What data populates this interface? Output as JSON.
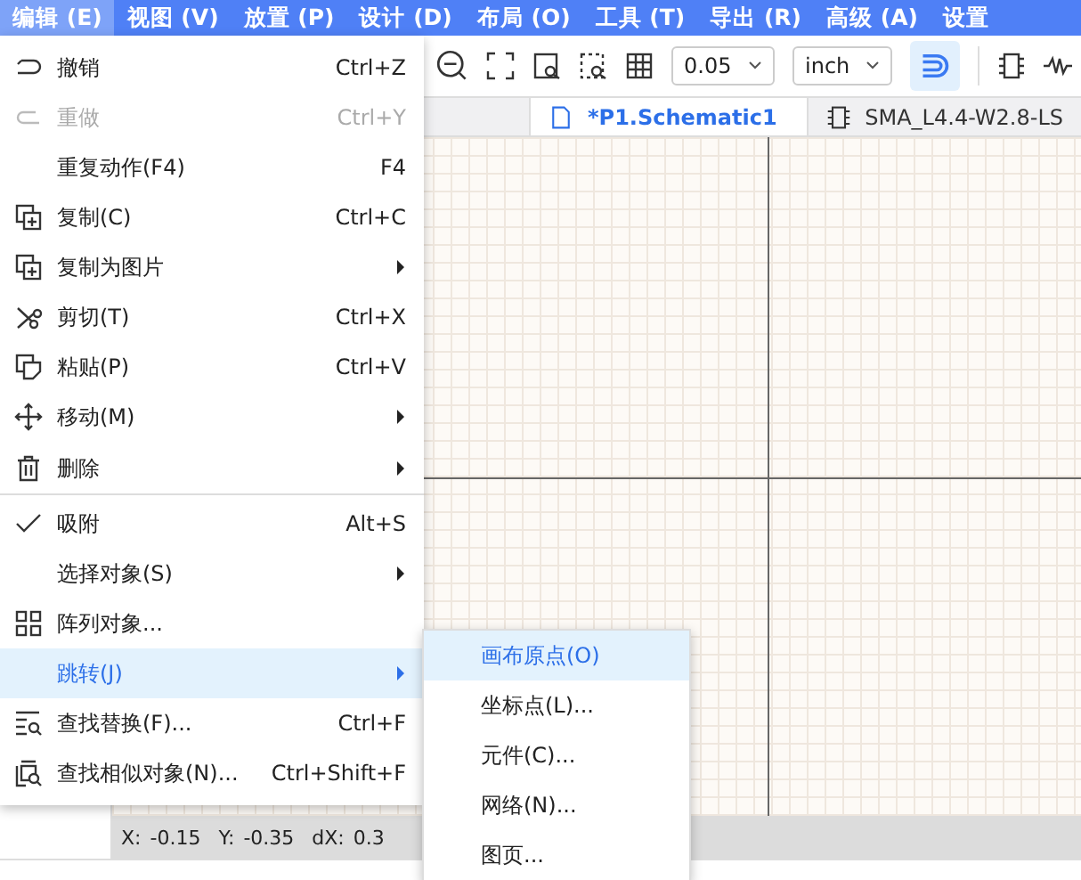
{
  "menubar": [
    {
      "label": "编辑 (E)",
      "selected": true
    },
    {
      "label": "视图 (V)",
      "selected": false
    },
    {
      "label": "放置 (P)",
      "selected": false
    },
    {
      "label": "设计 (D)",
      "selected": false
    },
    {
      "label": "布局 (O)",
      "selected": false
    },
    {
      "label": "工具 (T)",
      "selected": false
    },
    {
      "label": "导出 (R)",
      "selected": false
    },
    {
      "label": "高级 (A)",
      "selected": false
    },
    {
      "label": "设置",
      "selected": false
    }
  ],
  "toolbar": {
    "grid_size": "0.05",
    "unit": "inch",
    "snap_on": true
  },
  "tabs": [
    {
      "label": "*P1.Schematic1",
      "selected": true
    },
    {
      "label": "SMA_L4.4-W2.8-LS",
      "selected": false
    }
  ],
  "status_bar": [
    {
      "label": "X:",
      "value": "-0.15"
    },
    {
      "label": "Y:",
      "value": "-0.35"
    },
    {
      "label": "dX:",
      "value": "0.3"
    }
  ],
  "edit_menu": [
    {
      "label": "撤销",
      "shortcut": "Ctrl+Z",
      "submenu": false,
      "disabled": false,
      "checked": false,
      "selected": false,
      "divider_after": false
    },
    {
      "label": "重做",
      "shortcut": "Ctrl+Y",
      "submenu": false,
      "disabled": true,
      "checked": false,
      "selected": false,
      "divider_after": false
    },
    {
      "label": "重复动作(F4)",
      "shortcut": "F4",
      "submenu": false,
      "disabled": false,
      "checked": false,
      "selected": false,
      "divider_after": false
    },
    {
      "label": "复制(C)",
      "shortcut": "Ctrl+C",
      "submenu": false,
      "disabled": false,
      "checked": false,
      "selected": false,
      "divider_after": false
    },
    {
      "label": "复制为图片",
      "submenu": true,
      "disabled": false,
      "checked": false,
      "selected": false,
      "divider_after": false
    },
    {
      "label": "剪切(T)",
      "shortcut": "Ctrl+X",
      "submenu": false,
      "disabled": false,
      "checked": false,
      "selected": false,
      "divider_after": false
    },
    {
      "label": "粘贴(P)",
      "shortcut": "Ctrl+V",
      "submenu": false,
      "disabled": false,
      "checked": false,
      "selected": false,
      "divider_after": false
    },
    {
      "label": "移动(M)",
      "submenu": true,
      "disabled": false,
      "checked": false,
      "selected": false,
      "divider_after": false
    },
    {
      "label": "删除",
      "submenu": true,
      "disabled": false,
      "checked": false,
      "selected": false,
      "divider_after": true
    },
    {
      "label": "吸附",
      "shortcut": "Alt+S",
      "submenu": false,
      "disabled": false,
      "checked": true,
      "selected": false,
      "divider_after": false
    },
    {
      "label": "选择对象(S)",
      "submenu": true,
      "disabled": false,
      "checked": false,
      "selected": false,
      "divider_after": false
    },
    {
      "label": "阵列对象...",
      "submenu": false,
      "disabled": false,
      "checked": false,
      "selected": false,
      "divider_after": false
    },
    {
      "label": "跳转(J)",
      "submenu": true,
      "disabled": false,
      "checked": false,
      "selected": true,
      "divider_after": false
    },
    {
      "label": "查找替换(F)...",
      "shortcut": "Ctrl+F",
      "submenu": false,
      "disabled": false,
      "checked": false,
      "selected": false,
      "divider_after": false
    },
    {
      "label": "查找相似对象(N)...",
      "shortcut": "Ctrl+Shift+F",
      "submenu": false,
      "disabled": false,
      "checked": false,
      "selected": false,
      "divider_after": false
    }
  ],
  "jump_submenu": [
    {
      "label": "画布原点(O)",
      "selected": true
    },
    {
      "label": "坐标点(L)...",
      "selected": false
    },
    {
      "label": "元件(C)...",
      "selected": false
    },
    {
      "label": "网络(N)...",
      "selected": false
    },
    {
      "label": "图页...",
      "selected": false
    }
  ]
}
